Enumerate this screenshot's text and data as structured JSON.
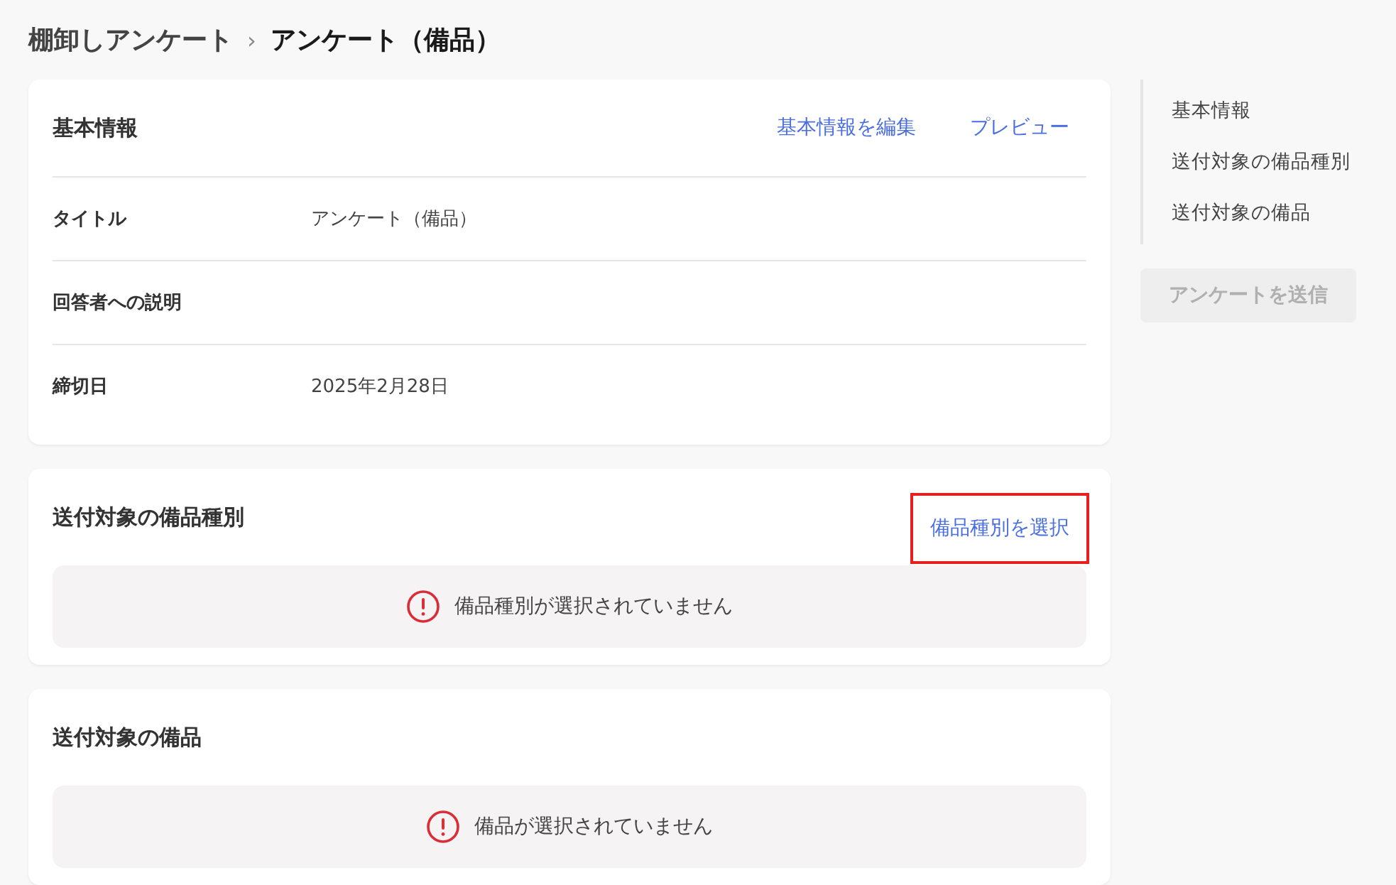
{
  "breadcrumb": [
    {
      "label": "棚卸しアンケート",
      "current": false
    },
    {
      "label": "アンケート（備品）",
      "current": true
    }
  ],
  "breadcrumb_separator": "›",
  "sections": [
    {
      "kind": "info",
      "title": "基本情報",
      "actions": [
        {
          "label": "基本情報を編集",
          "highlighted": false
        },
        {
          "label": "プレビュー",
          "highlighted": false
        }
      ],
      "rows": [
        {
          "label": "タイトル",
          "value": "アンケート（備品）"
        },
        {
          "label": "回答者への説明"
        },
        {
          "label": "締切日",
          "value": "2025年2月28日"
        }
      ]
    },
    {
      "kind": "empty",
      "title": "送付対象の備品種別",
      "actions": [
        {
          "label": "備品種別を選択",
          "highlighted": true
        }
      ],
      "message": "備品種別が選択されていません"
    },
    {
      "kind": "empty",
      "title": "送付対象の備品",
      "message": "備品が選択されていません"
    }
  ],
  "side_nav": {
    "items": [
      {
        "label": "基本情報"
      },
      {
        "label": "送付対象の備品種別"
      },
      {
        "label": "送付対象の備品"
      }
    ]
  },
  "submit_button": {
    "label": "アンケートを送信",
    "disabled": true
  }
}
